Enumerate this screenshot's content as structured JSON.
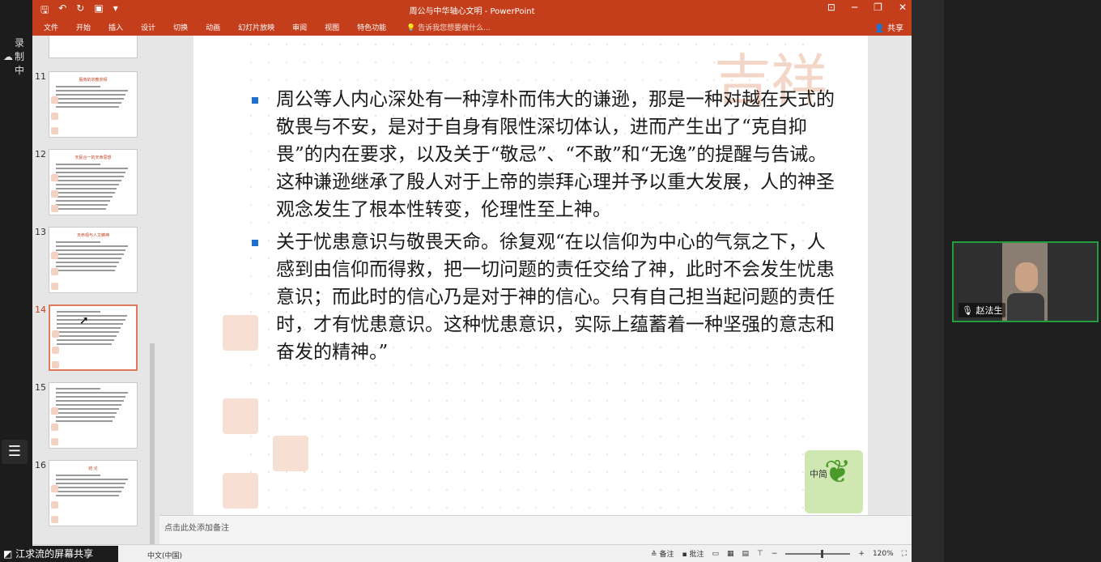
{
  "meeting": {
    "record_label": "录制中",
    "share_banner": "江求流的屏幕共享",
    "participant_name": "赵法生"
  },
  "window": {
    "title": "周公与中华轴心文明 - PowerPoint"
  },
  "ribbon": {
    "tabs": [
      "文件",
      "开始",
      "插入",
      "设计",
      "切换",
      "动画",
      "幻灯片放映",
      "审阅",
      "视图",
      "特色功能"
    ],
    "tell_me": "告诉我您想要做什么...",
    "share": "共享"
  },
  "thumbnails": [
    {
      "num": "11",
      "title": "殷商的宗教崇拜"
    },
    {
      "num": "12",
      "title": "天民合一的天命思想"
    },
    {
      "num": "13",
      "title": "天命观与人文精神"
    },
    {
      "num": "14",
      "title": ""
    },
    {
      "num": "15",
      "title": ""
    },
    {
      "num": "16",
      "title": "结 论"
    }
  ],
  "slide": {
    "bullets": [
      "周公等人内心深处有一种淳朴而伟大的谦逊，那是一种对越在天式的敬畏与不安，是对于自身有限性深切体认，进而产生出了“克自抑畏”的内在要求，以及关于“敬忌”、“不敢”和“无逸”的提醒与告诫。这种谦逊继承了殷人对于上帝的崇拜心理并予以重大发展，人的神圣观念发生了根本性转变，伦理性至上神。",
      "关于忧患意识与敬畏天命。徐复观“在以信仰为中心的气氛之下，人感到由信仰而得救，把一切问题的责任交给了神，此时不会发生忧患意识；而此时的信心乃是对于神的信心。只有自己担当起问题的责任时，才有忧患意识。这种忧患意识，实际上蕴蓄着一种坚强的意志和奋发的精神。”"
    ],
    "corner_text": "中简"
  },
  "notes_placeholder": "点击此处添加备注",
  "status": {
    "language": "中文(中国)",
    "notes_btn": "备注",
    "comments_btn": "批注",
    "zoom": "120%"
  }
}
